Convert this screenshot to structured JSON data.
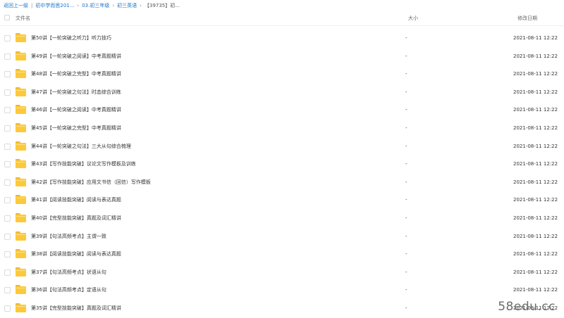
{
  "breadcrumb": {
    "back": "返回上一级",
    "items": [
      "初中学而思201...",
      "03.初三年级",
      "初三英语",
      "【39735】初..."
    ]
  },
  "header": {
    "name": "文件名",
    "size": "大小",
    "modified": "修改日期"
  },
  "files": [
    {
      "name": "第50讲【一轮突破之听力】听力技巧",
      "size": "-",
      "date": "2021-08-11 12:22"
    },
    {
      "name": "第49讲【一轮突破之阅读】中考真题精讲",
      "size": "-",
      "date": "2021-08-11 12:22"
    },
    {
      "name": "第48讲【一轮突破之完型】中考真题精讲",
      "size": "-",
      "date": "2021-08-11 12:22"
    },
    {
      "name": "第47讲【一轮突破之句法】时态综合训练",
      "size": "-",
      "date": "2021-08-11 12:22"
    },
    {
      "name": "第46讲【一轮突破之阅读】中考真题精讲",
      "size": "-",
      "date": "2021-08-11 12:22"
    },
    {
      "name": "第45讲【一轮突破之完型】中考真题精讲",
      "size": "-",
      "date": "2021-08-11 12:22"
    },
    {
      "name": "第44讲【一轮突破之句法】三大从句综合梳理",
      "size": "-",
      "date": "2021-08-11 12:22"
    },
    {
      "name": "第43讲【写作技能突破】议论文写作模板及训练",
      "size": "-",
      "date": "2021-08-11 12:22"
    },
    {
      "name": "第42讲【写作技能突破】应用文书信（回信）写作模板",
      "size": "-",
      "date": "2021-08-11 12:22"
    },
    {
      "name": "第41讲【阅读技能突破】阅读与表达真题",
      "size": "-",
      "date": "2021-08-11 12:22"
    },
    {
      "name": "第40讲【完型技能突破】真题及词汇精讲",
      "size": "-",
      "date": "2021-08-11 12:22"
    },
    {
      "name": "第39讲【句法高频考点】主谓一致",
      "size": "-",
      "date": "2021-08-11 12:22"
    },
    {
      "name": "第38讲【阅读技能突破】阅读与表达真题",
      "size": "-",
      "date": "2021-08-11 12:22"
    },
    {
      "name": "第37讲【句法高频考点】状语从句",
      "size": "-",
      "date": "2021-08-11 12:22"
    },
    {
      "name": "第36讲【句法高频考点】定语从句",
      "size": "-",
      "date": "2021-08-11 12:22"
    },
    {
      "name": "第35讲【完型技能突破】真题及词汇精讲",
      "size": "-",
      "date": "2021-08-11 12:22"
    }
  ],
  "watermark": "58edu.cc"
}
